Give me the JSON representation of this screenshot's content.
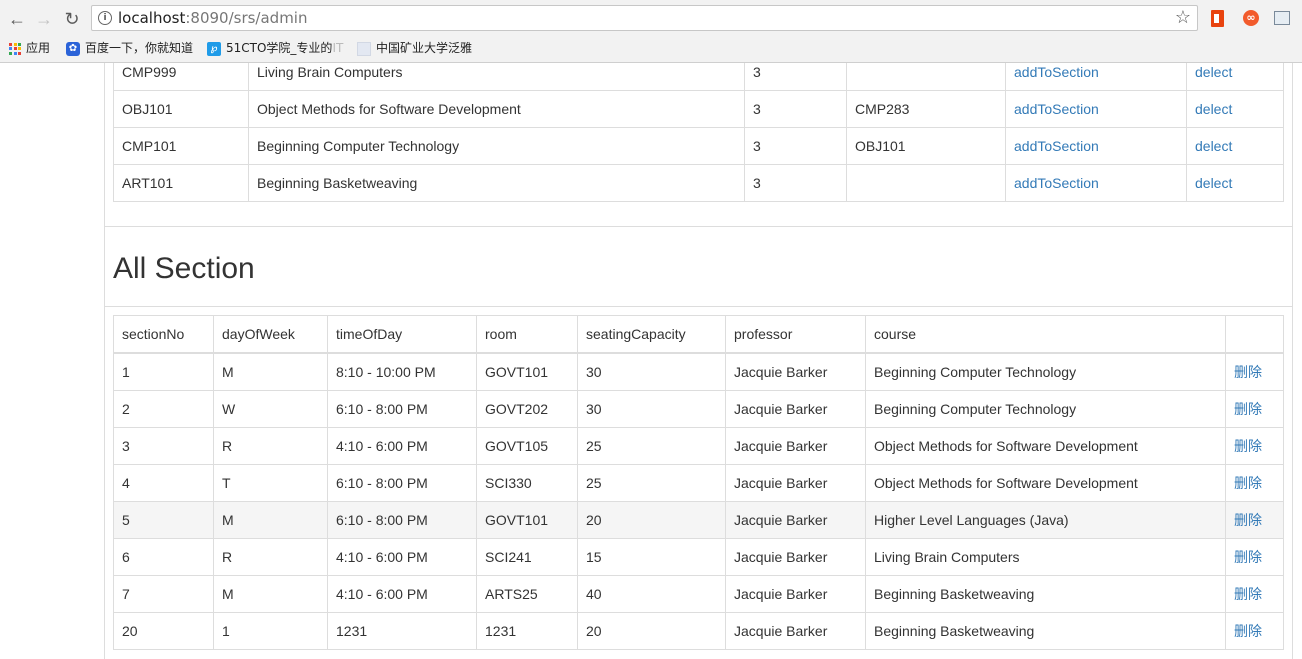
{
  "browser": {
    "url_host": "localhost",
    "url_path": ":8090/srs/admin",
    "bookmarks": [
      "应用",
      "百度一下，你就知道",
      "51CTO学院_专业的",
      "IT",
      "中国矿业大学泛雅"
    ]
  },
  "courses": {
    "rows": [
      {
        "id": "CMP999",
        "name": "Living Brain Computers",
        "credits": "3",
        "prereq": "",
        "add": "addToSection",
        "del": "delect"
      },
      {
        "id": "OBJ101",
        "name": "Object Methods for Software Development",
        "credits": "3",
        "prereq": "CMP283",
        "add": "addToSection",
        "del": "delect"
      },
      {
        "id": "CMP101",
        "name": "Beginning Computer Technology",
        "credits": "3",
        "prereq": "OBJ101",
        "add": "addToSection",
        "del": "delect"
      },
      {
        "id": "ART101",
        "name": "Beginning Basketweaving",
        "credits": "3",
        "prereq": "",
        "add": "addToSection",
        "del": "delect"
      }
    ]
  },
  "sections": {
    "heading": "All Section",
    "columns": [
      "sectionNo",
      "dayOfWeek",
      "timeOfDay",
      "room",
      "seatingCapacity",
      "professor",
      "course",
      ""
    ],
    "rows": [
      {
        "no": "1",
        "day": "M",
        "time": "8:10 - 10:00 PM",
        "room": "GOVT101",
        "cap": "30",
        "prof": "Jacquie Barker",
        "course": "Beginning Computer Technology",
        "action": "删除"
      },
      {
        "no": "2",
        "day": "W",
        "time": "6:10 - 8:00 PM",
        "room": "GOVT202",
        "cap": "30",
        "prof": "Jacquie Barker",
        "course": "Beginning Computer Technology",
        "action": "删除"
      },
      {
        "no": "3",
        "day": "R",
        "time": "4:10 - 6:00 PM",
        "room": "GOVT105",
        "cap": "25",
        "prof": "Jacquie Barker",
        "course": "Object Methods for Software Development",
        "action": "删除"
      },
      {
        "no": "4",
        "day": "T",
        "time": "6:10 - 8:00 PM",
        "room": "SCI330",
        "cap": "25",
        "prof": "Jacquie Barker",
        "course": "Object Methods for Software Development",
        "action": "删除"
      },
      {
        "no": "5",
        "day": "M",
        "time": "6:10 - 8:00 PM",
        "room": "GOVT101",
        "cap": "20",
        "prof": "Jacquie Barker",
        "course": "Higher Level Languages (Java)",
        "action": "删除"
      },
      {
        "no": "6",
        "day": "R",
        "time": "4:10 - 6:00 PM",
        "room": "SCI241",
        "cap": "15",
        "prof": "Jacquie Barker",
        "course": "Living Brain Computers",
        "action": "删除"
      },
      {
        "no": "7",
        "day": "M",
        "time": "4:10 - 6:00 PM",
        "room": "ARTS25",
        "cap": "40",
        "prof": "Jacquie Barker",
        "course": "Beginning Basketweaving",
        "action": "删除"
      },
      {
        "no": "20",
        "day": "1",
        "time": "1231",
        "room": "1231",
        "cap": "20",
        "prof": "Jacquie Barker",
        "course": "Beginning Basketweaving",
        "action": "删除"
      }
    ]
  },
  "colors": {
    "link": "#337ab7",
    "border": "#dddddd",
    "hover_row": "#f5f5f5"
  }
}
